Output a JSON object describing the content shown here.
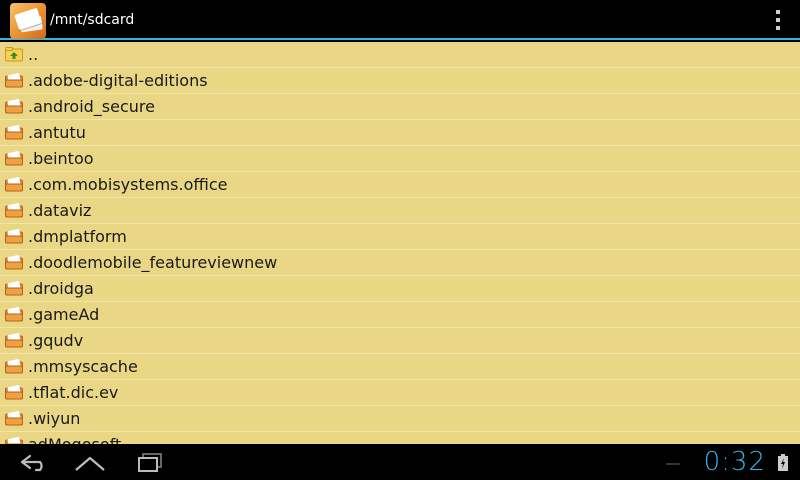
{
  "action_bar": {
    "title": "/mnt/sdcard",
    "accent_color": "#33b5e5",
    "app_icon": "file-manager-icon",
    "overflow_icon": "overflow-menu-icon"
  },
  "file_list": {
    "background_color": "#ead786",
    "items": [
      {
        "name": "..",
        "icon": "parent-folder-icon"
      },
      {
        "name": ".adobe-digital-editions",
        "icon": "folder-icon"
      },
      {
        "name": ".android_secure",
        "icon": "folder-icon"
      },
      {
        "name": ".antutu",
        "icon": "folder-icon"
      },
      {
        "name": ".beintoo",
        "icon": "folder-icon"
      },
      {
        "name": ".com.mobisystems.office",
        "icon": "folder-icon"
      },
      {
        "name": ".dataviz",
        "icon": "folder-icon"
      },
      {
        "name": ".dmplatform",
        "icon": "folder-icon"
      },
      {
        "name": ".doodlemobile_featureviewnew",
        "icon": "folder-icon"
      },
      {
        "name": ".droidga",
        "icon": "folder-icon"
      },
      {
        "name": ".gameAd",
        "icon": "folder-icon"
      },
      {
        "name": ".gqudv",
        "icon": "folder-icon"
      },
      {
        "name": ".mmsyscache",
        "icon": "folder-icon"
      },
      {
        "name": ".tflat.dic.ev",
        "icon": "folder-icon"
      },
      {
        "name": ".wiyun",
        "icon": "folder-icon"
      },
      {
        "name": "adMogosoft",
        "icon": "folder-icon"
      }
    ]
  },
  "nav_bar": {
    "back_icon": "back-icon",
    "home_icon": "home-icon",
    "recents_icon": "recent-apps-icon",
    "clock": "0:32",
    "battery_icon": "battery-charging-icon"
  }
}
